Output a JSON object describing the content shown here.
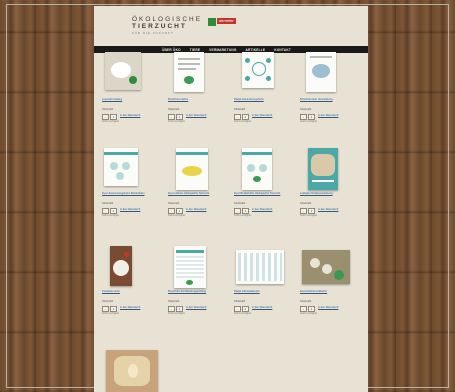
{
  "brand": {
    "line1": "ÖKOLOGISCHE",
    "line2": "TIERZUCHT",
    "sub": "FÜR DIE ZUKUNFT",
    "tag": "demeter"
  },
  "nav": [
    "ÜBER ÖKO",
    "TIERE",
    "VERMARKTUNG",
    "ARTIKELLE",
    "KONTAKT"
  ],
  "products": [
    {
      "caption": "Leporello Katalog",
      "qty_label": "Stückzahl",
      "add_label": "in den Warenkorb",
      "avail": "Sofort verfügbar"
    },
    {
      "caption": "Broschüre Hähne",
      "qty_label": "Stückzahl",
      "add_label": "in den Warenkorb",
      "avail": "Sofort verfügbar"
    },
    {
      "caption": "Plakat Zweinutzungshuhn",
      "qty_label": "Stückzahl",
      "add_label": "in den Warenkorb",
      "avail": "Sofort verfügbar"
    },
    {
      "caption": "Broschüre Eier Vermarktung",
      "qty_label": "Stückzahl",
      "add_label": "in den Warenkorb",
      "avail": "Sofort verfügbar"
    },
    {
      "caption": "Flyer Zweinutzungshuhn Brüderhahn",
      "qty_label": "Stückzahl",
      "add_label": "in den Warenkorb",
      "avail": "Sofort verfügbar"
    },
    {
      "caption": "Flyer Hühner Ökologische Tierzucht",
      "qty_label": "Stückzahl",
      "add_label": "in den Warenkorb",
      "avail": "Sofort verfügbar"
    },
    {
      "caption": "Flyer Bruderhahn Ökologische Tierzucht",
      "qty_label": "Stückzahl",
      "add_label": "in den Warenkorb",
      "avail": "Sofort verfügbar"
    },
    {
      "caption": "Leitfaden Direktvermarktung",
      "qty_label": "Stückzahl",
      "add_label": "in den Warenkorb",
      "avail": "Sofort verfügbar"
    },
    {
      "caption": "Postkarte Huhn",
      "qty_label": "Stückzahl",
      "add_label": "in den Warenkorb",
      "avail": "Sofort verfügbar"
    },
    {
      "caption": "Broschüre Zuchtleistungsprüfung",
      "qty_label": "Stückzahl",
      "add_label": "in den Warenkorb",
      "avail": "Sofort verfügbar"
    },
    {
      "caption": "Plakat Jahreskalender",
      "qty_label": "Stückzahl",
      "add_label": "in den Warenkorb",
      "avail": "Sofort verfügbar"
    },
    {
      "caption": "Eierschachtel Aufkleber",
      "qty_label": "Stückzahl",
      "add_label": "in den Warenkorb",
      "avail": "Sofort verfügbar"
    }
  ],
  "stepper": {
    "minus": "-",
    "value": "1",
    "plus": "+"
  }
}
